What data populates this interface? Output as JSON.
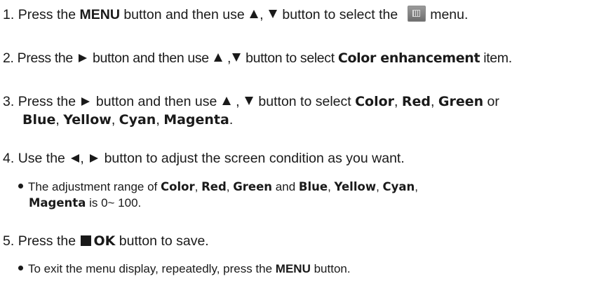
{
  "steps": [
    {
      "number": "1.",
      "text_a": "Press the",
      "menu_word": "MENU",
      "text_b": "button and then use",
      "sep": ",",
      "text_c": "button to select the",
      "text_d": "menu.",
      "icon": "picture-menu-icon"
    },
    {
      "number": "2.",
      "text_a": "Press the",
      "text_b": "button and then use",
      "sep": ",",
      "text_c": "button to select",
      "item": "Color enhancement",
      "text_d": "item."
    },
    {
      "number": "3.",
      "text_a": "Press the",
      "text_b": "button and then use",
      "sep": ",",
      "text_c": "button to select",
      "opt1": "Color",
      "comma": ",",
      "opt2": "Red",
      "opt3": "Green",
      "or_word": "or",
      "opt4": "Blue",
      "opt5": "Yellow",
      "opt6": "Cyan",
      "opt7": "Magenta",
      "period": "."
    },
    {
      "number": "4.",
      "text_a": "Use the",
      "sep": ",",
      "text_b": "button to adjust the screen condition as you want.",
      "note": {
        "text_a": "The adjustment range of",
        "opt1": "Color",
        "comma": ",",
        "opt2": "Red",
        "opt3": "Green",
        "and_word": "and",
        "opt4": "Blue",
        "opt5": "Yellow",
        "opt6": "Cyan",
        "opt7": "Magenta",
        "text_b": "is 0~ 100."
      }
    },
    {
      "number": "5.",
      "text_a": "Press the",
      "ok_word": "OK",
      "text_b": "button to save.",
      "note": {
        "text_a": "To exit the menu display, repeatedly, press the",
        "menu_word": "MENU",
        "text_b": "button."
      }
    }
  ]
}
